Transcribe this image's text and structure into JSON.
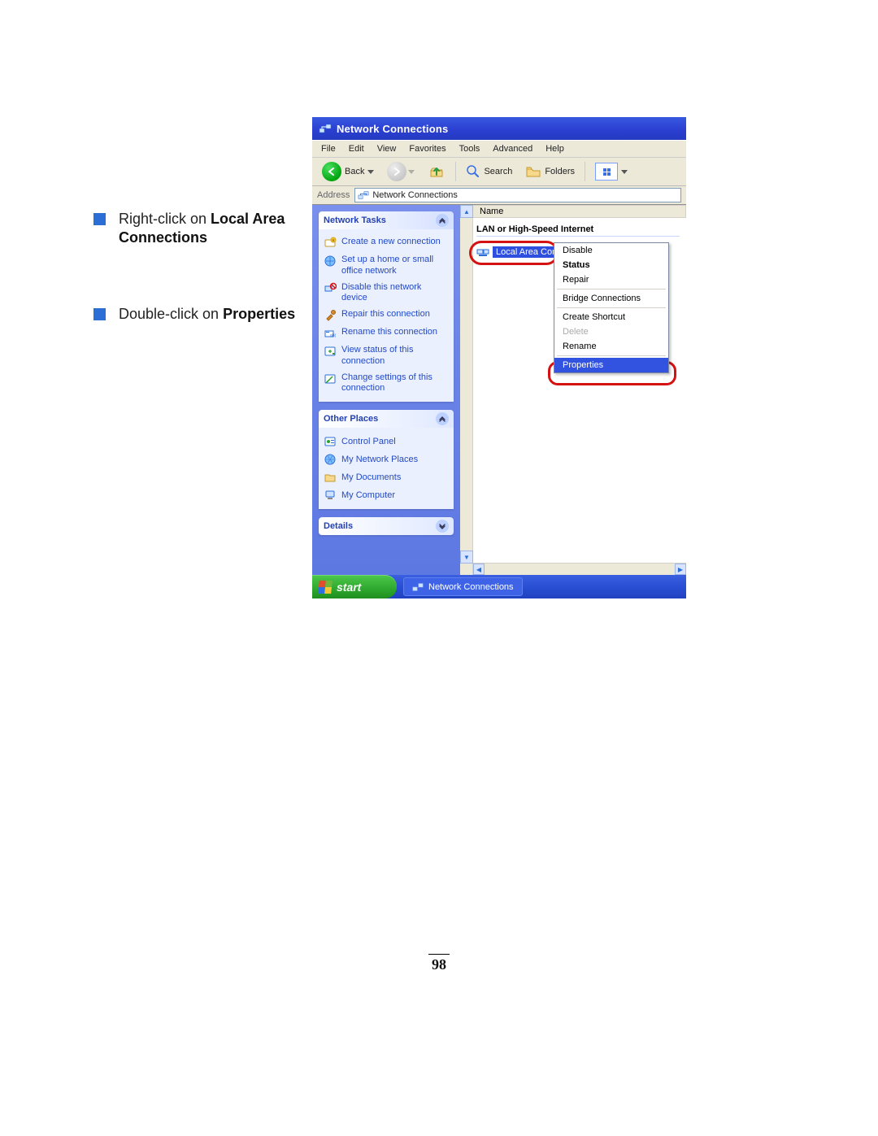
{
  "instructions": [
    {
      "pre": "Right-click on ",
      "bold": "Local Area Connections"
    },
    {
      "pre": "Double-click on ",
      "bold": "Properties"
    }
  ],
  "window": {
    "title": "Network Connections",
    "menus": [
      "File",
      "Edit",
      "View",
      "Favorites",
      "Tools",
      "Advanced",
      "Help"
    ],
    "toolbar": {
      "back": "Back",
      "search": "Search",
      "folders": "Folders"
    },
    "address": {
      "label": "Address",
      "value": "Network Connections"
    }
  },
  "sidebar": {
    "panels": [
      {
        "title": "Network Tasks",
        "items": [
          "Create a new connection",
          "Set up a home or small office network",
          "Disable this network device",
          "Repair this connection",
          "Rename this connection",
          "View status of this connection",
          "Change settings of this connection"
        ]
      },
      {
        "title": "Other Places",
        "items": [
          "Control Panel",
          "My Network Places",
          "My Documents",
          "My Computer"
        ]
      },
      {
        "title": "Details",
        "items": []
      }
    ]
  },
  "main": {
    "column_header": "Name",
    "group_header": "LAN or High-Speed Internet",
    "connection_label": "Local Area Con"
  },
  "context_menu": {
    "items": [
      {
        "label": "Disable",
        "type": "normal"
      },
      {
        "label": "Status",
        "type": "bold"
      },
      {
        "label": "Repair",
        "type": "normal"
      },
      {
        "label": "—sep—",
        "type": "sep"
      },
      {
        "label": "Bridge Connections",
        "type": "normal"
      },
      {
        "label": "—sep—",
        "type": "sep"
      },
      {
        "label": "Create Shortcut",
        "type": "normal"
      },
      {
        "label": "Delete",
        "type": "disabled"
      },
      {
        "label": "Rename",
        "type": "normal"
      },
      {
        "label": "—sep—",
        "type": "sep"
      },
      {
        "label": "Properties",
        "type": "sel"
      }
    ]
  },
  "taskbar": {
    "start": "start",
    "app": "Network Connections"
  },
  "page_number": "98"
}
